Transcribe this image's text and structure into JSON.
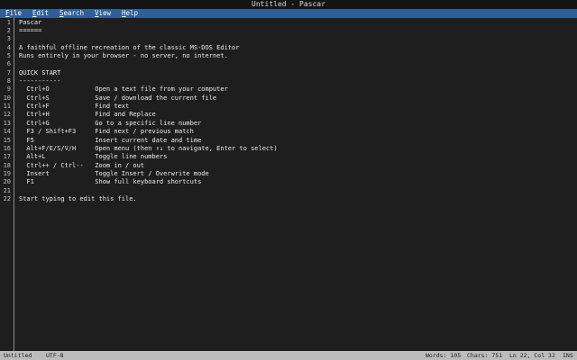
{
  "window": {
    "title": "Untitled - Pascar"
  },
  "menu": {
    "items": [
      {
        "hotkey": "F",
        "rest": "ile"
      },
      {
        "hotkey": "E",
        "rest": "dit"
      },
      {
        "hotkey": "S",
        "rest": "earch"
      },
      {
        "hotkey": "V",
        "rest": "iew"
      },
      {
        "hotkey": "H",
        "rest": "elp"
      }
    ]
  },
  "editor": {
    "line_numbers": [
      "1",
      "2",
      "3",
      "4",
      "5",
      "6",
      "7",
      "8",
      "9",
      "10",
      "11",
      "12",
      "13",
      "14",
      "15",
      "16",
      "17",
      "18",
      "19",
      "20",
      "21",
      "22"
    ],
    "lines": [
      "Pascar",
      "======",
      "",
      "A faithful offline recreation of the classic MS-DOS Editor",
      "Runs entirely in your browser - no server, no internet.",
      "",
      "QUICK START",
      "-----------",
      "  Ctrl+O            Open a text file from your computer",
      "  Ctrl+S            Save / download the current file",
      "  Ctrl+F            Find text",
      "  Ctrl+H            Find and Replace",
      "  Ctrl+G            Go to a specific line number",
      "  F3 / Shift+F3     Find next / previous match",
      "  F5                Insert current date and time",
      "  Alt+F/E/S/V/H     Open menu (then ↑↓ to navigate, Enter to select)",
      "  Alt+L             Toggle line numbers",
      "  Ctrl++ / Ctrl--   Zoom in / out",
      "  Insert            Toggle Insert / Overwrite mode",
      "  F1                Show full keyboard shortcuts",
      "",
      "Start typing to edit this file."
    ]
  },
  "status": {
    "filename": "Untitled",
    "encoding": "UTF-8",
    "words": "Words: 105",
    "chars": "Chars: 751",
    "position": "Ln 22, Col 32",
    "mode": "INS"
  }
}
